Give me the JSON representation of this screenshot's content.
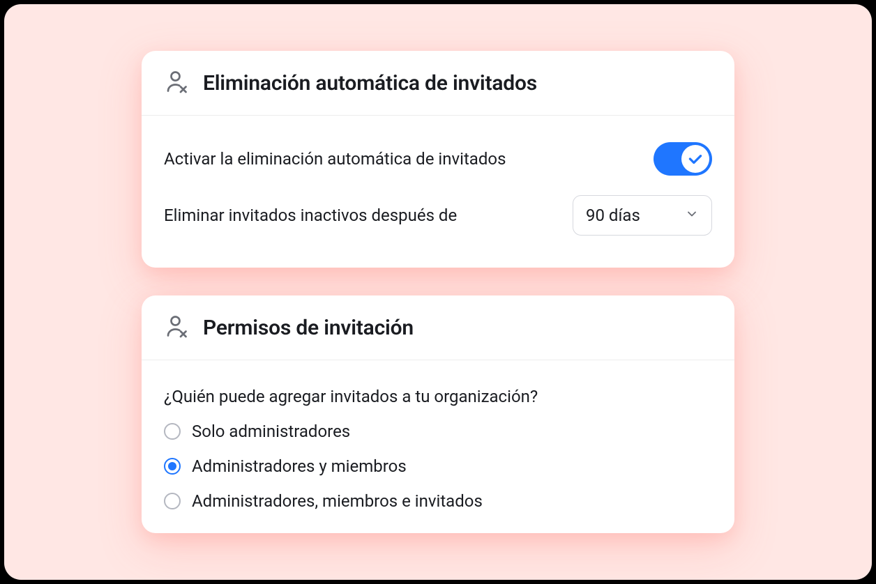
{
  "card1": {
    "title": "Eliminación automática de invitados",
    "toggle_label": "Activar la eliminación automática de invitados",
    "toggle_on": true,
    "days_label": "Eliminar invitados inactivos después de",
    "days_value": "90 días"
  },
  "card2": {
    "title": "Permisos de invitación",
    "question": "¿Quién puede agregar invitados a tu organización?",
    "options": [
      {
        "label": "Solo administradores",
        "selected": false
      },
      {
        "label": "Administradores y miembros",
        "selected": true
      },
      {
        "label": "Administradores, miembros e invitados",
        "selected": false
      }
    ]
  }
}
